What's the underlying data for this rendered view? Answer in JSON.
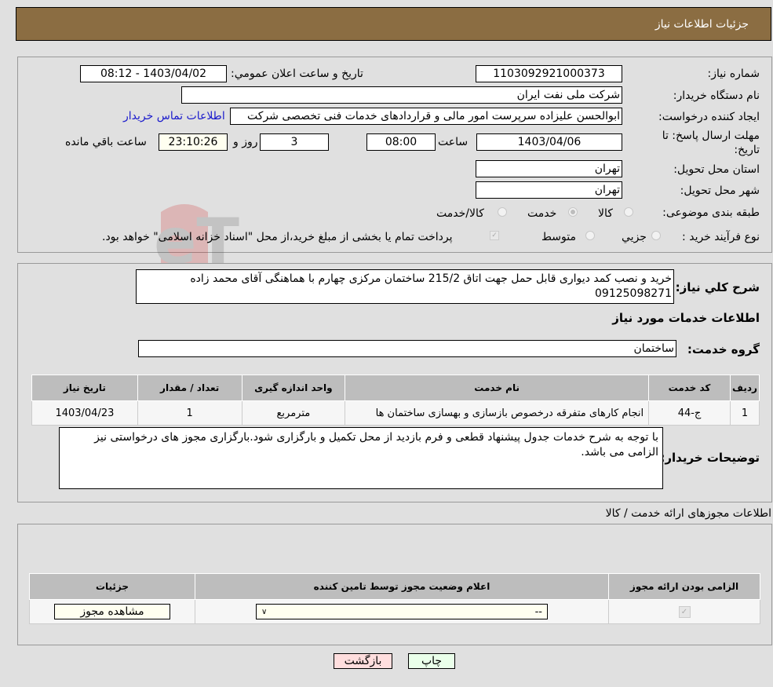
{
  "header": {
    "title": "جزئیات اطلاعات نیاز"
  },
  "form": {
    "need_number_label": "شماره نیاز:",
    "need_number": "1103092921000373",
    "announce_label": "تاریخ و ساعت اعلان عمومي:",
    "announce_value": "1403/04/02 - 08:12",
    "buyer_org_label": "نام دستگاه خریدار:",
    "buyer_org": "شرکت ملی نفت ایران",
    "creator_label": "ایجاد کننده درخواست:",
    "creator": "ابوالحسن علیزاده سرپرست امور مالی و قراردادهای خدمات فنی تخصصی شرکت",
    "contact_link": "اطلاعات تماس خریدار",
    "deadline_label_1": "مهلت ارسال پاسخ: تا",
    "deadline_label_2": "تاریخ:",
    "deadline_date": "1403/04/06",
    "time_label": "ساعت",
    "deadline_time": "08:00",
    "days": "3",
    "days_label": "روز و",
    "remaining": "23:10:26",
    "remaining_label": "ساعت باقي مانده",
    "province_label": "استان محل تحویل:",
    "province": "تهران",
    "city_label": "شهر محل تحویل:",
    "city": "تهران",
    "category_label": "طبقه بندی موضوعی:",
    "category_options": [
      "کالا",
      "خدمت",
      "کالا/خدمت"
    ],
    "category_selected": "خدمت",
    "process_label": "نوع فرآیند خرید :",
    "process_options": [
      "جزيي",
      "متوسط"
    ],
    "treasury_note": "پرداخت تمام یا بخشی از مبلغ خرید،از محل \"اسناد خزانه اسلامی\" خواهد بود."
  },
  "description": {
    "label": "شرح کلي نیاز:",
    "text": "خرید و نصب کمد دیواری قابل حمل جهت اتاق 215/2 ساختمان مرکزی چهارم با هماهنگی آقای محمد زاده 09125098271"
  },
  "services": {
    "section_title": "اطلاعات خدمات مورد نیاز",
    "group_label": "گروه خدمت:",
    "group": "ساختمان",
    "columns": [
      "ردیف",
      "کد خدمت",
      "نام خدمت",
      "واحد اندازه گیری",
      "تعداد / مقدار",
      "تاریخ نیاز"
    ],
    "rows": [
      {
        "row": "1",
        "code": "ج-44",
        "name": "انجام کارهای متفرقه درخصوص بازسازی و بهسازی ساختمان ها",
        "unit": "مترمربع",
        "qty": "1",
        "date": "1403/04/23"
      }
    ]
  },
  "buyer_notes": {
    "label": "توضیحات خریدار:",
    "text": "با توجه به شرح خدمات جدول پیشنهاد قطعی و فرم بازدید از محل تکمیل و بارگزاری شود.بارگزاری مجوز های درخواستی نیز الزامی می باشد."
  },
  "permits": {
    "section_title": "اطلاعات مجوزهای ارائه خدمت / کالا",
    "columns": [
      "الزامی بودن ارائه مجوز",
      "اعلام وضعیت مجوز توسط تامین کننده",
      "جزئیات"
    ],
    "rows": [
      {
        "required": true,
        "status": "--",
        "details_button": "مشاهده مجوز"
      }
    ]
  },
  "buttons": {
    "print": "چاپ",
    "back": "بازگشت"
  },
  "colors": {
    "header": "#8b6d42",
    "link": "#1a1acc",
    "print_bg": "#eaffea",
    "back_bg": "#ffdede",
    "highlight_bg": "#fffff0"
  }
}
